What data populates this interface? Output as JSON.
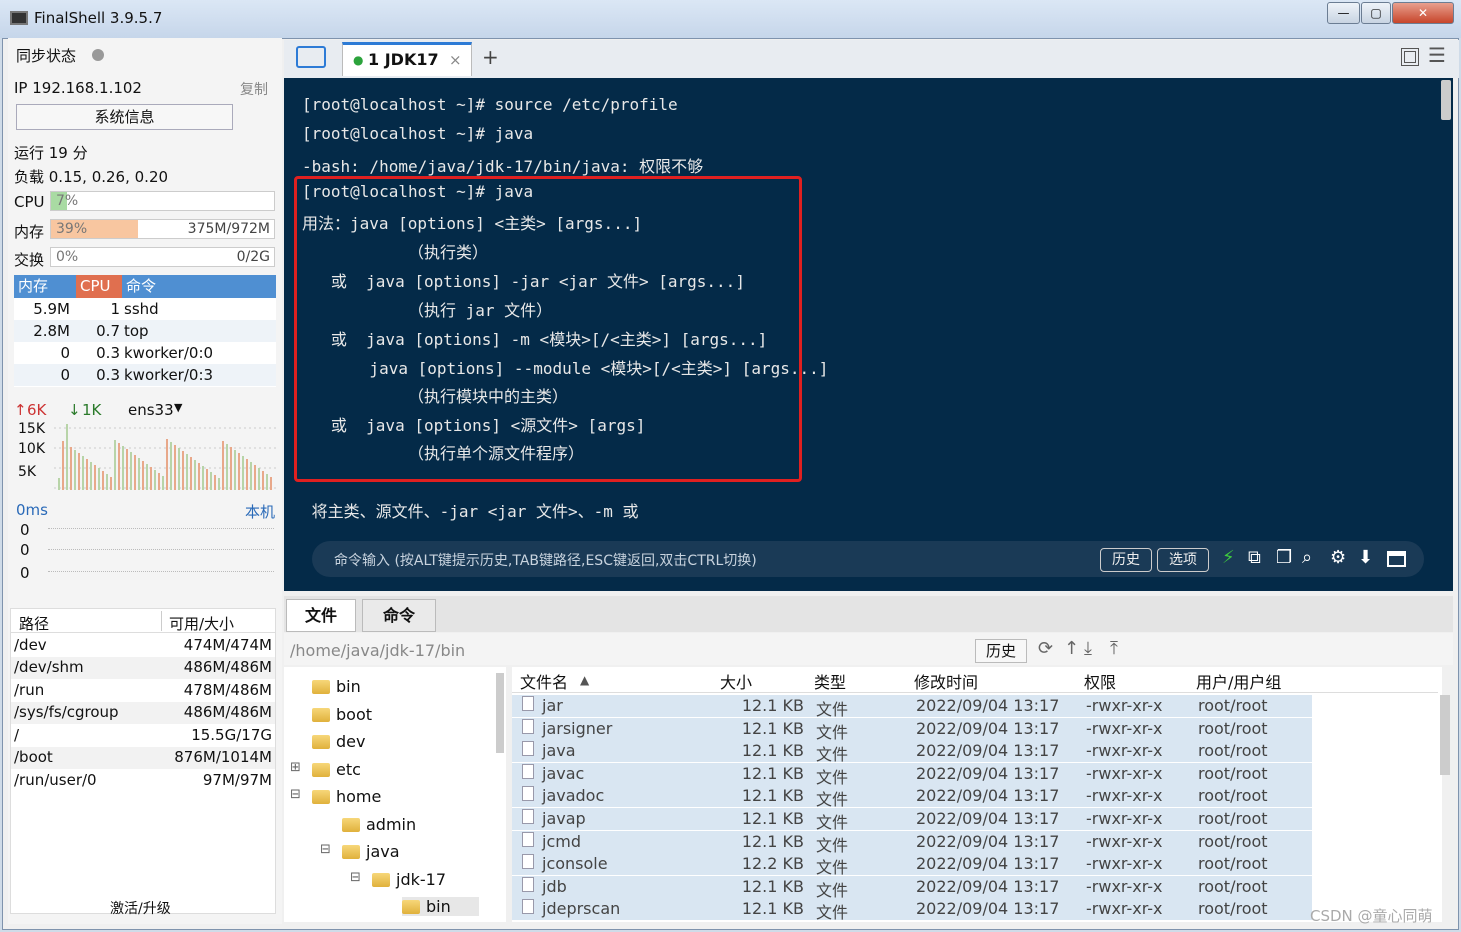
{
  "app": {
    "title": "FinalShell 3.9.5.7"
  },
  "left": {
    "sync_label": "同步状态",
    "ip": "IP 192.168.1.102",
    "copy": "复制",
    "sysinfo_btn": "系统信息",
    "uptime": "运行 19 分",
    "load": "负载 0.15, 0.26, 0.20",
    "cpu_label": "CPU",
    "cpu_pct": "7%",
    "cpu_level": 7,
    "mem_label": "内存",
    "mem_pct": "39%",
    "mem_val": "375M/972M",
    "mem_level": 39,
    "swap_label": "交换",
    "swap_pct": "0%",
    "swap_val": "0/2G",
    "swap_level": 0,
    "proc_headers": [
      "内存",
      "CPU",
      "命令"
    ],
    "procs": [
      {
        "mem": "5.9M",
        "cpu": "1",
        "cmd": "sshd"
      },
      {
        "mem": "2.8M",
        "cpu": "0.7",
        "cmd": "top"
      },
      {
        "mem": "0",
        "cpu": "0.3",
        "cmd": "kworker/0:0"
      },
      {
        "mem": "0",
        "cpu": "0.3",
        "cmd": "kworker/0:3"
      }
    ],
    "net_up": "6K",
    "net_down": "1K",
    "net_iface": "ens33",
    "net_ticks": [
      "15K",
      "10K",
      "5K"
    ],
    "ping_ms": "0ms",
    "ping_host": "本机",
    "ping_vals": [
      "0",
      "0",
      "0"
    ],
    "fs_headers": [
      "路径",
      "可用/大小"
    ],
    "fs": [
      {
        "path": "/dev",
        "size": "474M/474M"
      },
      {
        "path": "/dev/shm",
        "size": "486M/486M"
      },
      {
        "path": "/run",
        "size": "478M/486M"
      },
      {
        "path": "/sys/fs/cgroup",
        "size": "486M/486M"
      },
      {
        "path": "/",
        "size": "15.5G/17G"
      },
      {
        "path": "/boot",
        "size": "876M/1014M"
      },
      {
        "path": "/run/user/0",
        "size": "97M/97M"
      }
    ],
    "activate": "激活/升级"
  },
  "tabs": {
    "session": "1 JDK17",
    "close": "×",
    "add": "+"
  },
  "terminal": {
    "lines": [
      "[root@localhost ~]# source /etc/profile",
      "[root@localhost ~]# java",
      "-bash: /home/java/jdk-17/bin/java: 权限不够",
      "[root@localhost ~]# java",
      "用法：java [options] <主类> [args...]",
      "           （执行类）",
      "   或  java [options] -jar <jar 文件> [args...]",
      "           （执行 jar 文件）",
      "   或  java [options] -m <模块>[/<主类>] [args...]",
      "       java [options] --module <模块>[/<主类>] [args...]",
      "           （执行模块中的主类）",
      "   或  java [options] <源文件> [args]",
      "           （执行单个源文件程序）",
      "",
      " 将主类、源文件、-jar <jar 文件>、-m 或"
    ]
  },
  "cmd": {
    "placeholder": "命令输入 (按ALT键提示历史,TAB键路径,ESC键返回,双击CTRL切换)",
    "history": "历史",
    "options": "选项"
  },
  "files": {
    "tab_files": "文件",
    "tab_cmds": "命令",
    "path": "/home/java/jdk-17/bin",
    "history": "历史",
    "tree": [
      {
        "name": "bin",
        "indent": 0,
        "exp": ""
      },
      {
        "name": "boot",
        "indent": 0,
        "exp": ""
      },
      {
        "name": "dev",
        "indent": 0,
        "exp": ""
      },
      {
        "name": "etc",
        "indent": 0,
        "exp": "+"
      },
      {
        "name": "home",
        "indent": 0,
        "exp": "-"
      },
      {
        "name": "admin",
        "indent": 1,
        "exp": ""
      },
      {
        "name": "java",
        "indent": 1,
        "exp": "-"
      },
      {
        "name": "jdk-17",
        "indent": 2,
        "exp": "-"
      },
      {
        "name": "bin",
        "indent": 3,
        "exp": ""
      }
    ],
    "headers": [
      "文件名",
      "大小",
      "类型",
      "修改时间",
      "权限",
      "用户/用户组"
    ],
    "rows": [
      {
        "name": "jar",
        "size": "12.1 KB",
        "type": "文件",
        "time": "2022/09/04 13:17",
        "perm": "-rwxr-xr-x",
        "owner": "root/root"
      },
      {
        "name": "jarsigner",
        "size": "12.1 KB",
        "type": "文件",
        "time": "2022/09/04 13:17",
        "perm": "-rwxr-xr-x",
        "owner": "root/root"
      },
      {
        "name": "java",
        "size": "12.1 KB",
        "type": "文件",
        "time": "2022/09/04 13:17",
        "perm": "-rwxr-xr-x",
        "owner": "root/root"
      },
      {
        "name": "javac",
        "size": "12.1 KB",
        "type": "文件",
        "time": "2022/09/04 13:17",
        "perm": "-rwxr-xr-x",
        "owner": "root/root"
      },
      {
        "name": "javadoc",
        "size": "12.1 KB",
        "type": "文件",
        "time": "2022/09/04 13:17",
        "perm": "-rwxr-xr-x",
        "owner": "root/root"
      },
      {
        "name": "javap",
        "size": "12.1 KB",
        "type": "文件",
        "time": "2022/09/04 13:17",
        "perm": "-rwxr-xr-x",
        "owner": "root/root"
      },
      {
        "name": "jcmd",
        "size": "12.1 KB",
        "type": "文件",
        "time": "2022/09/04 13:17",
        "perm": "-rwxr-xr-x",
        "owner": "root/root"
      },
      {
        "name": "jconsole",
        "size": "12.2 KB",
        "type": "文件",
        "time": "2022/09/04 13:17",
        "perm": "-rwxr-xr-x",
        "owner": "root/root"
      },
      {
        "name": "jdb",
        "size": "12.1 KB",
        "type": "文件",
        "time": "2022/09/04 13:17",
        "perm": "-rwxr-xr-x",
        "owner": "root/root"
      },
      {
        "name": "jdeprscan",
        "size": "12.1 KB",
        "type": "文件",
        "time": "2022/09/04 13:17",
        "perm": "-rwxr-xr-x",
        "owner": "root/root"
      }
    ]
  },
  "watermark": "CSDN @童心同萌"
}
